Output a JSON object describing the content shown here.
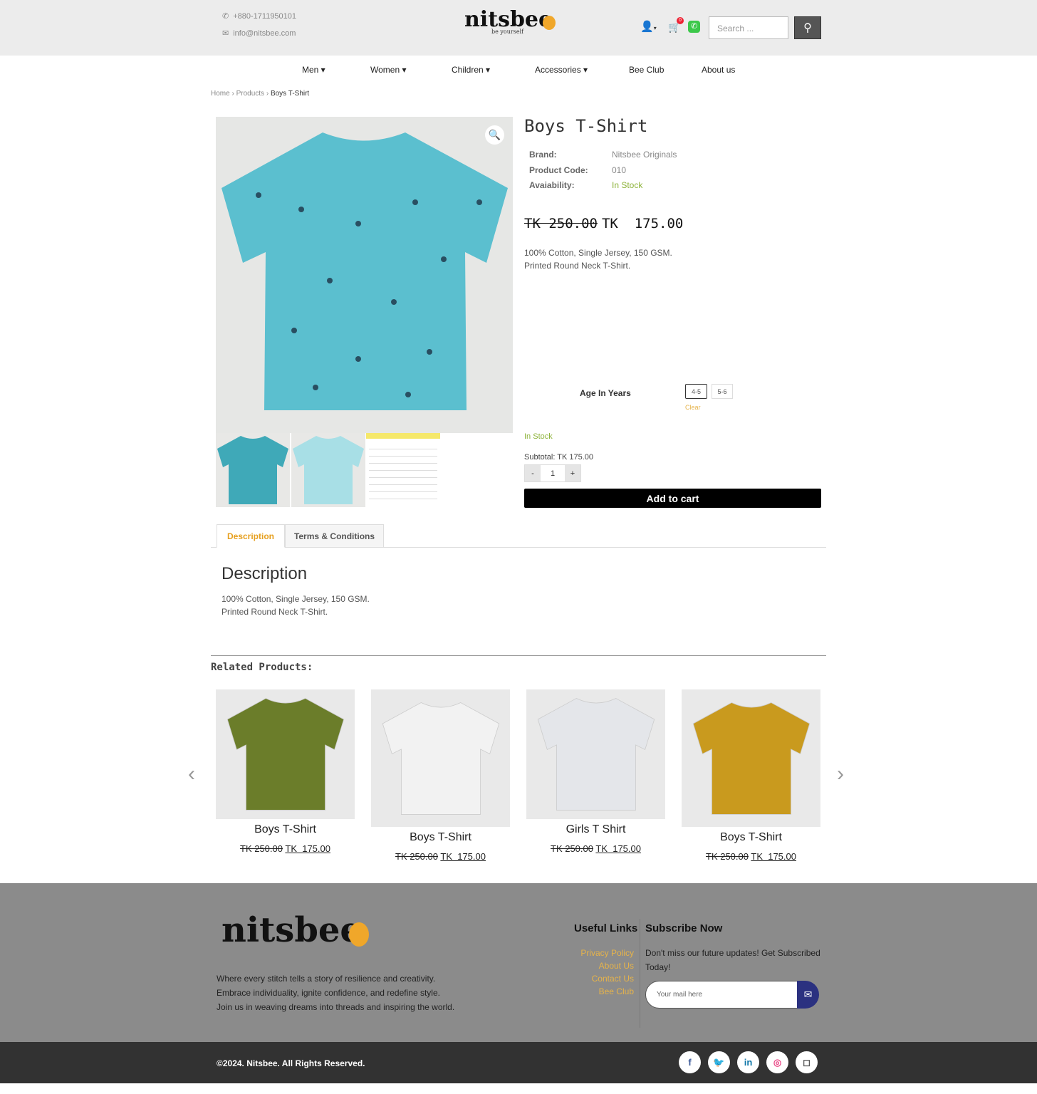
{
  "header": {
    "phone": "+880-1711950101",
    "email": "info@nitsbee.com",
    "logo": "nitsbee",
    "tagline": "be yourself",
    "cart_count": "0",
    "search_placeholder": "Search ..."
  },
  "nav": [
    "Men",
    "Women",
    "Children",
    "Accessories",
    "Bee Club",
    "About us"
  ],
  "breadcrumb": [
    "Home",
    "Products",
    "Boys T-Shirt"
  ],
  "product": {
    "title": "Boys T-Shirt",
    "brand_label": "Brand:",
    "brand": "Nitsbee Originals",
    "code_label": "Product Code:",
    "code": "010",
    "avail_label": "Avaiability:",
    "avail": "In Stock",
    "old_price": "TK 250.00",
    "price": "TK  175.00",
    "desc1": "100% Cotton, Single Jersey, 150 GSM.",
    "desc2": "Printed Round Neck T-Shirt.",
    "age_label": "Age In Years",
    "ages": [
      "4-5",
      "5-6"
    ],
    "clear": "Clear",
    "stock": "In Stock",
    "subtotal": "Subtotal: TK 175.00",
    "qty": "1",
    "minus": "-",
    "plus": "+",
    "add_to_cart": "Add to cart",
    "image_color": "#5bbfcf",
    "thumb_size_chart": "SIZE CHART"
  },
  "tabs": [
    "Description",
    "Terms & Conditions"
  ],
  "description": {
    "heading": "Description",
    "line1": "100% Cotton, Single Jersey, 150 GSM.",
    "line2": "Printed Round Neck T-Shirt."
  },
  "related": {
    "heading": "Related Products:",
    "items": [
      {
        "name": "Boys T-Shirt",
        "old": "TK 250.00",
        "price": "TK  175.00",
        "color": "#6b7d2a"
      },
      {
        "name": "Boys T-Shirt",
        "old": "TK 250.00",
        "price": "TK  175.00",
        "color": "#f2f2f2"
      },
      {
        "name": "Girls T Shirt",
        "old": "TK 250.00",
        "price": "TK  175.00",
        "color": "#e4e6ea"
      },
      {
        "name": "Boys T-Shirt",
        "old": "TK 250.00",
        "price": "TK  175.00",
        "color": "#c99a1e"
      }
    ]
  },
  "footer": {
    "logo": "nitsbee",
    "about1": "Where every stitch tells a story of resilience and creativity.",
    "about2": "Embrace individuality, ignite confidence, and redefine style.",
    "about3": "Join us in weaving dreams into threads and inspiring the world.",
    "links_heading": "Useful Links",
    "links": [
      "Privacy Policy",
      "About Us",
      "Contact Us",
      "Bee Club"
    ],
    "subscribe_heading": "Subscribe Now",
    "subscribe_text": "Don't miss our future updates! Get Subscribed Today!",
    "email_placeholder": "Your mail here",
    "copyright": "©2024. Nitsbee. All Rights Reserved."
  },
  "colors": {
    "accent": "#e6b34a",
    "in_stock": "#8db33a",
    "subscribe_btn": "#2b3180"
  }
}
